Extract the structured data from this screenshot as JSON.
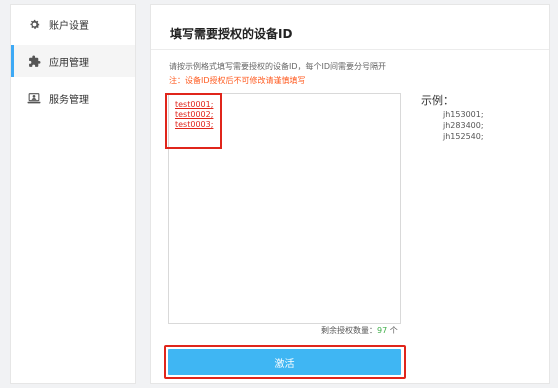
{
  "sidebar": {
    "items": [
      {
        "label": "账户设置",
        "icon": "gear-icon"
      },
      {
        "label": "应用管理",
        "icon": "puzzle-icon",
        "active": true
      },
      {
        "label": "服务管理",
        "icon": "monitor-user-icon"
      }
    ]
  },
  "main": {
    "title": "填写需要授权的设备ID",
    "hint": "请按示例格式填写需要授权的设备ID，每个ID间需要分号隔开",
    "warning": "注：设备ID授权后不可修改请谨慎填写",
    "entered_ids": [
      "test0001;",
      "test0002;",
      "test0003;"
    ],
    "example": {
      "title": "示例：",
      "items": [
        "jh153001;",
        "jh283400;",
        "jh152540;"
      ]
    },
    "remaining": {
      "label": "剩余授权数量：",
      "count": "97",
      "unit": "个"
    },
    "activate_label": "激活"
  },
  "colors": {
    "accent": "#3fb6f3",
    "warning": "#ff5a1f",
    "highlight": "#e0251b",
    "count": "#3fae49"
  }
}
